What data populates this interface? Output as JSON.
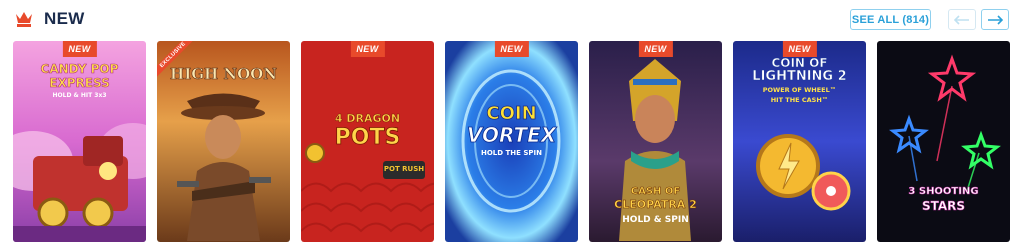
{
  "section": {
    "title": "NEW",
    "icon": "crown-icon",
    "see_all_label": "SEE ALL (814)",
    "prev_icon": "arrow-left-icon",
    "next_icon": "arrow-right-icon"
  },
  "tag_new": "NEW",
  "tag_exclusive": "EXCLUSIVE",
  "games": [
    {
      "title_line1": "CANDY POP",
      "title_line2": "EXPRESS",
      "subtitle": "HOLD & HIT 3x3"
    },
    {
      "title_line1": "HIGH NOON"
    },
    {
      "title_line1": "4 DRAGON",
      "title_line2": "POTS",
      "subtitle": "POT RUSH"
    },
    {
      "title_line1": "COIN",
      "title_line2": "VORTEX",
      "subtitle": "HOLD THE SPIN"
    },
    {
      "title_line1": "CASH OF",
      "title_line2": "CLEOPATRA 2",
      "subtitle": "HOLD & SPIN"
    },
    {
      "title_line1": "COIN OF",
      "title_line2": "LIGHTNING 2",
      "subtitle": "POWER OF WHEEL™",
      "subtitle2": "HIT THE CASH™"
    },
    {
      "title_line1": "3 SHOOTING",
      "title_line2": "STARS"
    }
  ],
  "colors": {
    "title": "#1a2b4c",
    "accent": "#2aa0d8",
    "tag": "#e84a2b"
  }
}
